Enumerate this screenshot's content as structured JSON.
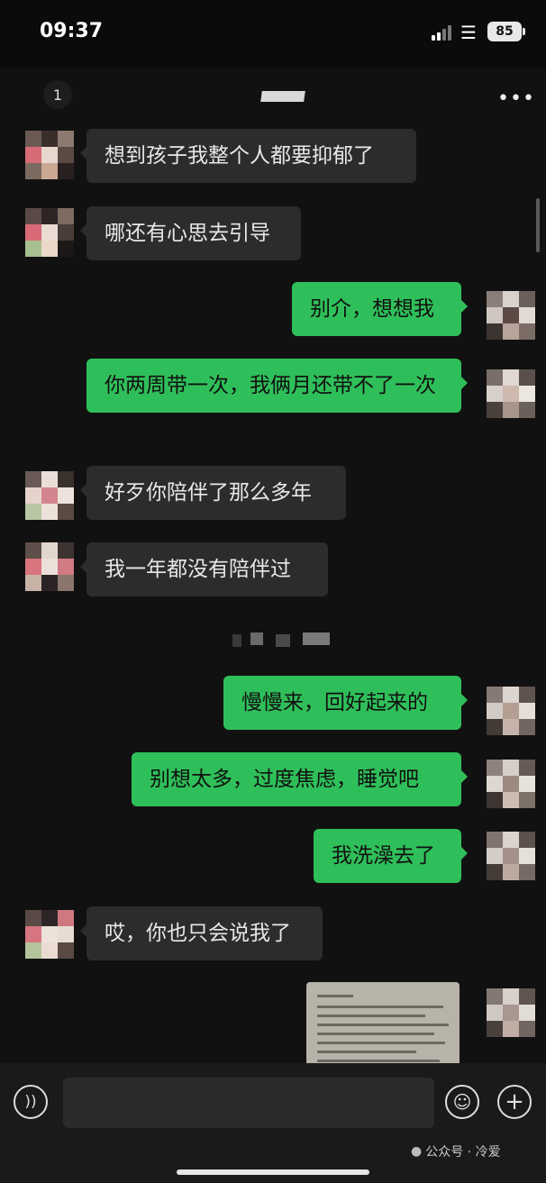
{
  "status_bar": {
    "time": "09:37",
    "battery": "85"
  },
  "nav": {
    "unread_count": "1",
    "more_icon": "more-icon"
  },
  "messages": [
    {
      "side": "in",
      "text": "想到孩子我整个人都要抑郁了"
    },
    {
      "side": "in",
      "text": "哪还有心思去引导"
    },
    {
      "side": "out",
      "text": "别介，想想我"
    },
    {
      "side": "out",
      "text": "你两周带一次，我俩月还带不了一次"
    },
    {
      "side": "in",
      "text": "好歹你陪伴了那么多年"
    },
    {
      "side": "in",
      "text": "我一年都没有陪伴过"
    },
    {
      "side": "out",
      "text": "慢慢来，回好起来的"
    },
    {
      "side": "out",
      "text": "别想太多，过度焦虑，睡觉吧"
    },
    {
      "side": "out",
      "text": "我洗澡去了"
    },
    {
      "side": "in",
      "text": "哎，你也只会说我了"
    },
    {
      "side": "out",
      "type": "image"
    }
  ],
  "input_bar": {
    "voice_icon": "voice-icon",
    "emoji_icon": "emoji-icon",
    "plus_icon": "plus-icon"
  },
  "watermark": {
    "text": "公众号 · 冷爱"
  },
  "colors": {
    "incoming_bubble": "#2c2c2c",
    "outgoing_bubble": "#2fbf5a",
    "background": "#111111"
  }
}
